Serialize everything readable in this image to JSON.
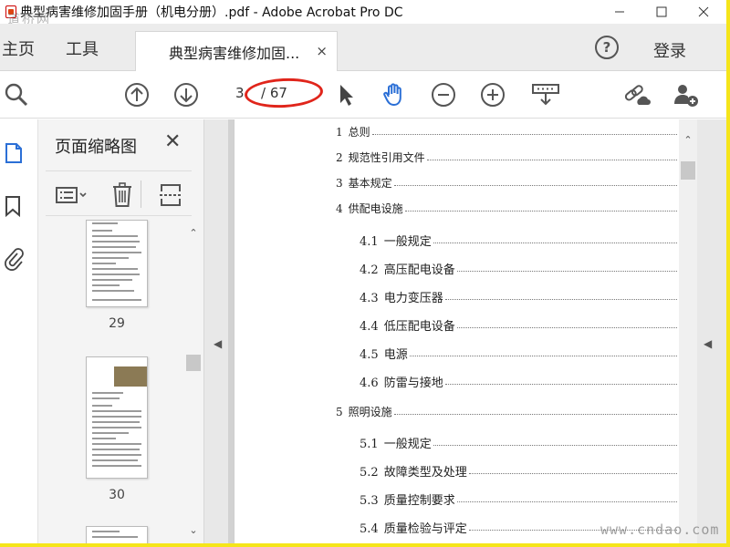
{
  "window": {
    "title": "典型病害维修加固手册（机电分册）.pdf - Adobe Acrobat Pro DC",
    "watermark_top": "道桥网",
    "watermark_bottom": "www.cndao.com"
  },
  "tabs": {
    "home": "主页",
    "tools": "工具",
    "document": "典型病害维修加固...",
    "close_glyph": "×",
    "help": "?",
    "login": "登录"
  },
  "toolbar": {
    "icons": [
      "zoom-icon",
      "page-up-icon",
      "page-down-icon",
      "select-cursor-icon",
      "hand-tool-icon",
      "zoom-out-icon",
      "zoom-in-icon",
      "keyboard-icon",
      "share-link-icon",
      "add-user-icon"
    ],
    "current_page": "3",
    "total_pages": "/ 67"
  },
  "rail": {
    "icons": [
      "page-thumbnails-icon",
      "bookmark-icon",
      "attachment-icon"
    ]
  },
  "thumbnails": {
    "title": "页面缩略图",
    "close_glyph": "✕",
    "pages": [
      {
        "number": "29"
      },
      {
        "number": "30"
      }
    ]
  },
  "toc": [
    {
      "num": "1",
      "label": "总则",
      "level": 1
    },
    {
      "num": "2",
      "label": "规范性引用文件",
      "level": 1
    },
    {
      "num": "3",
      "label": "基本规定",
      "level": 1
    },
    {
      "num": "4",
      "label": "供配电设施",
      "level": 1
    },
    {
      "num": "4.1",
      "label": "一般规定",
      "level": 2
    },
    {
      "num": "4.2",
      "label": "高压配电设备",
      "level": 2
    },
    {
      "num": "4.3",
      "label": "电力变压器",
      "level": 2
    },
    {
      "num": "4.4",
      "label": "低压配电设备",
      "level": 2
    },
    {
      "num": "4.5",
      "label": "电源",
      "level": 2
    },
    {
      "num": "4.6",
      "label": "防雷与接地",
      "level": 2
    },
    {
      "num": "5",
      "label": "照明设施",
      "level": 1
    },
    {
      "num": "5.1",
      "label": "一般规定",
      "level": 2
    },
    {
      "num": "5.2",
      "label": "故障类型及处理",
      "level": 2
    },
    {
      "num": "5.3",
      "label": "质量控制要求",
      "level": 2
    },
    {
      "num": "5.4",
      "label": "质量检验与评定",
      "level": 2
    }
  ],
  "colors": {
    "annotation_red": "#e0251b",
    "frame_yellow": "#f5e51a",
    "hand_tool_blue": "#2b6fd6"
  }
}
